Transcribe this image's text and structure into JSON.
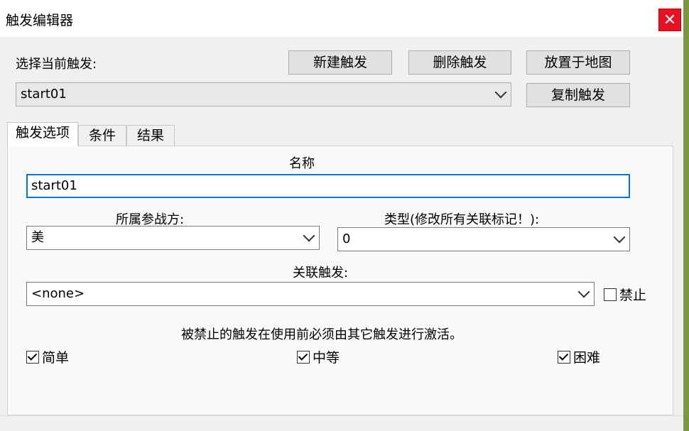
{
  "window": {
    "title": "触发编辑器",
    "close_label": "✕"
  },
  "header": {
    "select_label": "选择当前触发:",
    "current_trigger": "start01",
    "buttons": {
      "new": "新建触发",
      "delete": "删除触发",
      "place": "放置于地图",
      "copy": "复制触发"
    }
  },
  "tabs": [
    {
      "label": "触发选项",
      "active": true
    },
    {
      "label": "条件",
      "active": false
    },
    {
      "label": "结果",
      "active": false
    }
  ],
  "options": {
    "name_label": "名称",
    "name_value": "start01",
    "side_label": "所属参战方:",
    "side_value": "美",
    "type_label": "类型(修改所有关联标记！):",
    "type_value": "0",
    "linked_label": "关联触发:",
    "linked_value": "<none>",
    "disable_label": "禁止",
    "disable_checked": false,
    "note": "被禁止的触发在使用前必须由其它触发进行激活。",
    "difficulty": {
      "easy": "简单",
      "medium": "中等",
      "hard": "困难"
    }
  }
}
